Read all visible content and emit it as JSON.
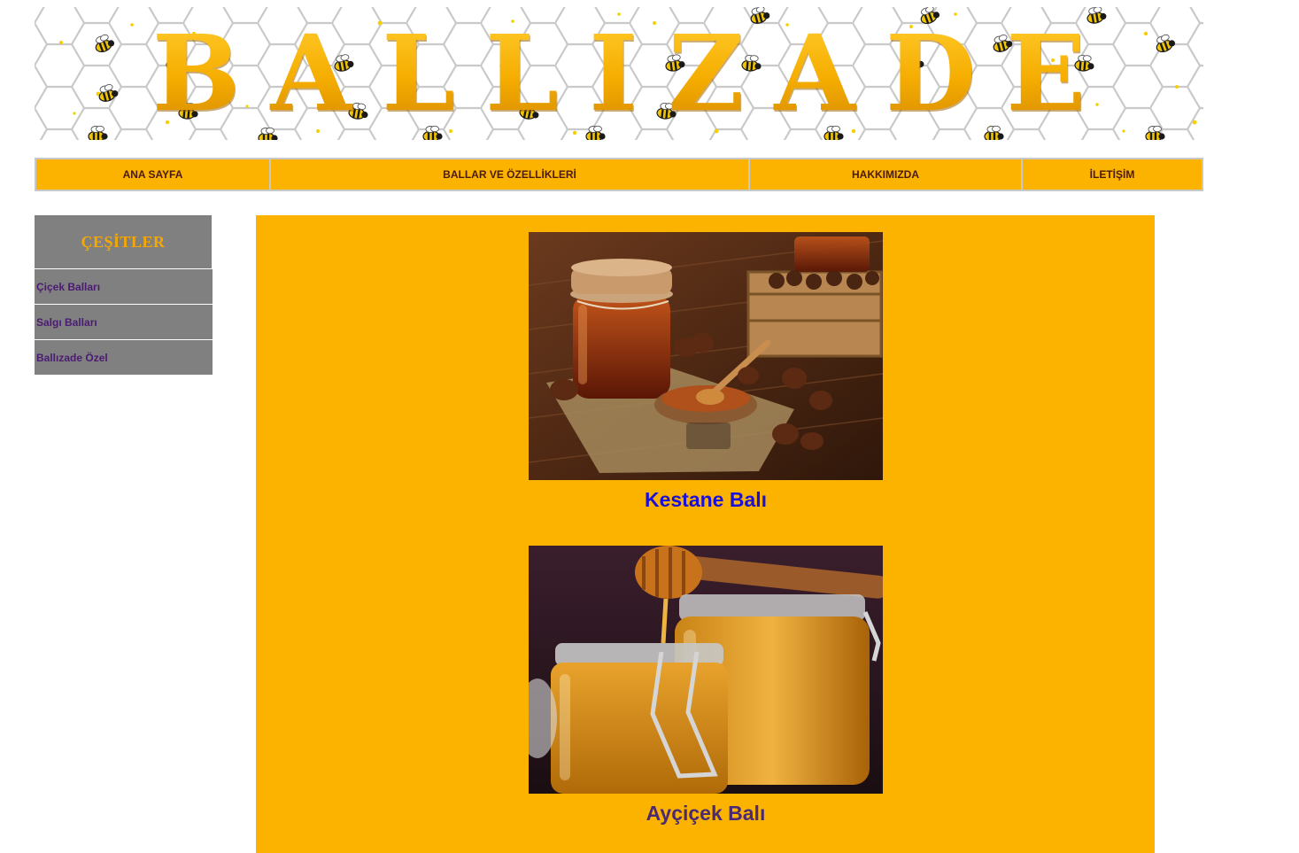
{
  "banner": {
    "title": "BALLIZADE",
    "icon": "bee-honeycomb-pattern"
  },
  "nav": {
    "items": [
      {
        "label": "ANA SAYFA"
      },
      {
        "label": "BALLAR VE ÖZELLİKLERİ"
      },
      {
        "label": "HAKKIMIZDA"
      },
      {
        "label": "İLETİŞİM"
      }
    ]
  },
  "sidebar": {
    "title": "ÇEŞİTLER",
    "items": [
      {
        "label": "Çiçek Balları"
      },
      {
        "label": "Salgı Balları"
      },
      {
        "label": "Ballızade Özel"
      }
    ]
  },
  "main": {
    "products": [
      {
        "name": "Kestane Balı",
        "image": "chestnut-honey-photo"
      },
      {
        "name": "Ayçiçek Balı",
        "image": "sunflower-honey-photo"
      }
    ]
  },
  "colors": {
    "accent": "#fbb300",
    "sidebar_bg": "#808080",
    "sidebar_title": "#f7a800",
    "link": "#4b1a73",
    "caption_1": "#1a10d8",
    "caption_2": "#4b2a72"
  }
}
